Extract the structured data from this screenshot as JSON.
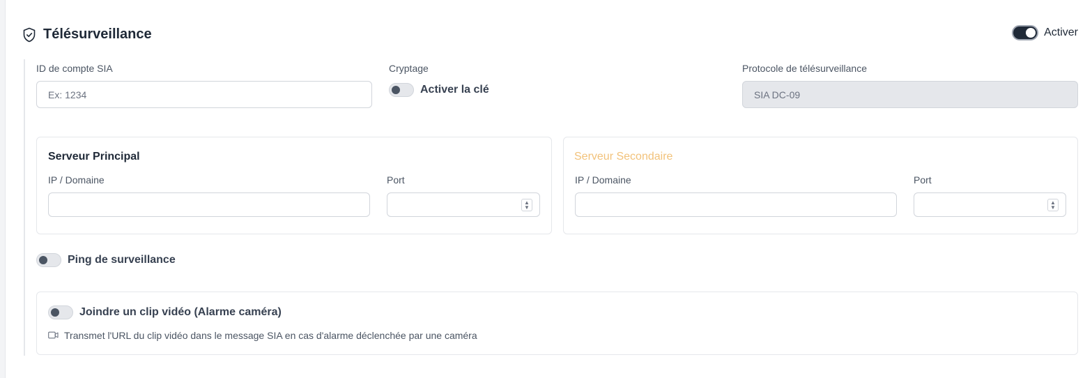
{
  "header": {
    "title": "Télésurveillance",
    "icon": "shield-check-icon",
    "enable_label": "Activer",
    "enabled": true
  },
  "fields": {
    "sia_account": {
      "label": "ID de compte SIA",
      "placeholder": "Ex: 1234",
      "value": ""
    },
    "encryption": {
      "label": "Cryptage",
      "toggle_label": "Activer la clé",
      "enabled": false
    },
    "protocol": {
      "label": "Protocole de télésurveillance",
      "value": "SIA DC-09"
    }
  },
  "primary_server": {
    "title": "Serveur Principal",
    "ip_label": "IP / Domaine",
    "ip_value": "",
    "port_label": "Port",
    "port_value": ""
  },
  "secondary_server": {
    "title": "Serveur Secondaire",
    "ip_label": "IP / Domaine",
    "ip_value": "",
    "port_label": "Port",
    "port_value": ""
  },
  "ping": {
    "label": "Ping de surveillance",
    "enabled": false
  },
  "video_clip": {
    "label": "Joindre un clip vidéo (Alarme caméra)",
    "enabled": false,
    "hint": "Transmet l'URL du clip vidéo dans le message SIA en cas d'alarme déclenchée par une caméra",
    "hint_icon": "video-camera-icon"
  },
  "colors": {
    "accent_dark": "#1f2937",
    "secondary_title": "#f2c27a",
    "border": "#e5e7eb"
  }
}
